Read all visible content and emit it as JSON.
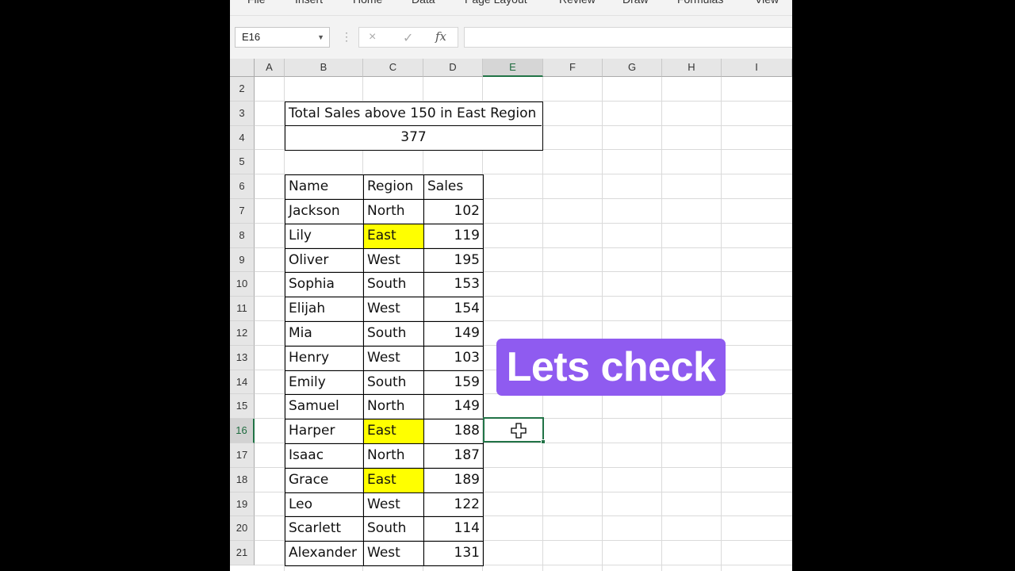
{
  "ribbon": {
    "tabs": [
      "File",
      "Insert",
      "Home",
      "Data",
      "Page Layout",
      "Review",
      "Draw",
      "Formulas",
      "View"
    ]
  },
  "formula_bar": {
    "name_box": "E16",
    "cancel_icon": "×",
    "enter_icon": "✓",
    "fx_label": "fx",
    "formula": ""
  },
  "grid": {
    "columns": [
      "A",
      "B",
      "C",
      "D",
      "E",
      "F",
      "G",
      "H",
      "I"
    ],
    "active_column": "E",
    "rows": [
      "2",
      "3",
      "4",
      "5",
      "6",
      "7",
      "8",
      "9",
      "10",
      "11",
      "12",
      "13",
      "14",
      "15",
      "16",
      "17",
      "18",
      "19",
      "20",
      "21"
    ],
    "active_row": "16"
  },
  "summary": {
    "title": "Total Sales above 150 in East Region",
    "value": "377"
  },
  "table": {
    "headers": [
      "Name",
      "Region",
      "Sales"
    ],
    "rows": [
      {
        "name": "Jackson",
        "region": "North",
        "sales": "102",
        "highlight": false
      },
      {
        "name": "Lily",
        "region": "East",
        "sales": "119",
        "highlight": true
      },
      {
        "name": "Oliver",
        "region": "West",
        "sales": "195",
        "highlight": false
      },
      {
        "name": "Sophia",
        "region": "South",
        "sales": "153",
        "highlight": false
      },
      {
        "name": "Elijah",
        "region": "West",
        "sales": "154",
        "highlight": false
      },
      {
        "name": "Mia",
        "region": "South",
        "sales": "149",
        "highlight": false
      },
      {
        "name": "Henry",
        "region": "West",
        "sales": "103",
        "highlight": false
      },
      {
        "name": "Emily",
        "region": "South",
        "sales": "159",
        "highlight": false
      },
      {
        "name": "Samuel",
        "region": "North",
        "sales": "149",
        "highlight": false
      },
      {
        "name": "Harper",
        "region": "East",
        "sales": "188",
        "highlight": true
      },
      {
        "name": "Isaac",
        "region": "North",
        "sales": "187",
        "highlight": false
      },
      {
        "name": "Grace",
        "region": "East",
        "sales": "189",
        "highlight": true
      },
      {
        "name": "Leo",
        "region": "West",
        "sales": "122",
        "highlight": false
      },
      {
        "name": "Scarlett",
        "region": "South",
        "sales": "114",
        "highlight": false
      },
      {
        "name": "Alexander",
        "region": "West",
        "sales": "131",
        "highlight": false
      }
    ]
  },
  "overlay": {
    "text": "Lets check"
  },
  "colors": {
    "highlight": "#ffff00",
    "selection": "#217346",
    "overlay_bg": "#8f5bf0"
  }
}
